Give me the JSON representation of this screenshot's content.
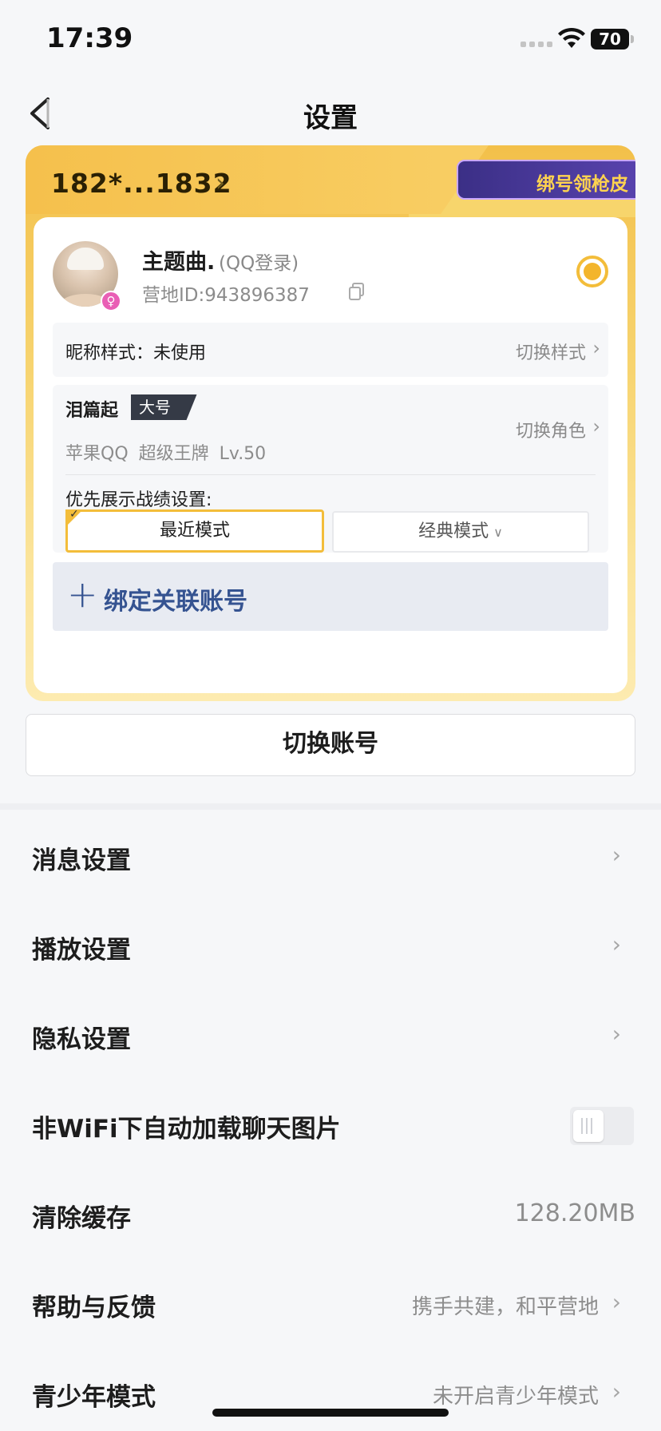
{
  "status_bar": {
    "time": "17:39",
    "battery": "70"
  },
  "nav": {
    "title": "设置"
  },
  "account_card": {
    "phone": "182*...1832",
    "bind_promo": "绑号领枪皮",
    "nickname": "主题曲.",
    "login_type": "(QQ登录)",
    "camp_id": "营地ID:943896387",
    "nick_style_label": "昵称样式：未使用",
    "nick_style_action": "切换样式",
    "role_name": "泪篇起",
    "role_badge": "大号",
    "role_info": "苹果QQ 超级王牌 Lv.50",
    "role_action": "切换角色",
    "priority_label": "优先展示战绩设置:",
    "mode_recent": "最近模式",
    "mode_classic": "经典模式",
    "bind_linked": "绑定关联账号",
    "accent_color": "#f3bd3a"
  },
  "switch_account": "切换账号",
  "settings": [
    {
      "label": "消息设置",
      "type": "nav"
    },
    {
      "label": "播放设置",
      "type": "nav"
    },
    {
      "label": "隐私设置",
      "type": "nav"
    },
    {
      "label": "非WiFi下自动加载聊天图片",
      "type": "toggle",
      "on": false
    },
    {
      "label": "清除缓存",
      "type": "value",
      "value": "128.20MB"
    },
    {
      "label": "帮助与反馈",
      "type": "nav-value",
      "value": "携手共建，和平营地"
    },
    {
      "label": "青少年模式",
      "type": "nav-value",
      "value": "未开启青少年模式"
    }
  ]
}
